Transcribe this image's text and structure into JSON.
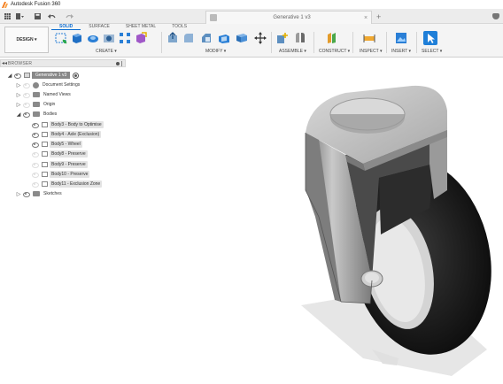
{
  "window": {
    "title": "Autodesk Fusion 360"
  },
  "tabs": {
    "document_title": "Generative 1 v3",
    "close_label": "×",
    "new_tab": "+"
  },
  "ribbon": {
    "workspace_label": "DESIGN ▾",
    "tabs": [
      "SOLID",
      "SURFACE",
      "SHEET METAL",
      "TOOLS"
    ],
    "active_tab": "SOLID",
    "groups": {
      "create": "CREATE ▾",
      "modify": "MODIFY ▾",
      "assemble": "ASSEMBLE ▾",
      "construct": "CONSTRUCT ▾",
      "inspect": "INSPECT ▾",
      "insert": "INSERT ▾",
      "select": "SELECT ▾"
    }
  },
  "browser": {
    "header": "BROWSER",
    "root": "Generative 1 v3",
    "items": [
      {
        "label": "Document Settings",
        "type": "settings"
      },
      {
        "label": "Named Views",
        "type": "folder"
      },
      {
        "label": "Origin",
        "type": "folder"
      },
      {
        "label": "Bodies",
        "type": "folder"
      },
      {
        "label": "Body3 - Body to Optimise",
        "type": "body"
      },
      {
        "label": "Body4 - Axle (Exclusion)",
        "type": "body"
      },
      {
        "label": "Body5 - Wheel",
        "type": "body"
      },
      {
        "label": "Body8 - Preserve",
        "type": "body"
      },
      {
        "label": "Body9 - Preserve",
        "type": "body"
      },
      {
        "label": "Body10 - Preserve",
        "type": "body"
      },
      {
        "label": "Body11 - Exclusion Zone",
        "type": "body"
      },
      {
        "label": "Sketches",
        "type": "folder"
      }
    ]
  },
  "colors": {
    "accent": "#0b6bd0",
    "wheel": "#1e1e1e",
    "hub": "#d6d6d6",
    "metal": "#8f8f8f"
  }
}
